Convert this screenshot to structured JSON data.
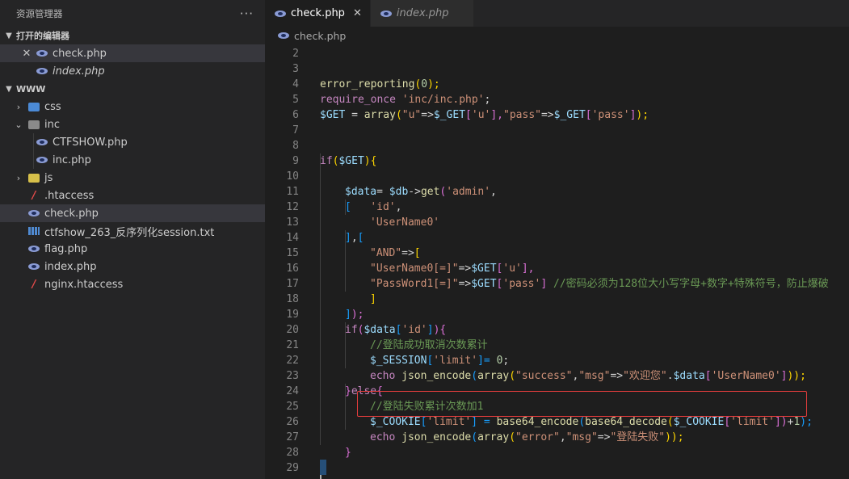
{
  "sidebar": {
    "title": "资源管理器",
    "more": "···",
    "open_editors": {
      "label": "打开的编辑器",
      "items": [
        {
          "label": "check.php"
        },
        {
          "label": "index.php"
        }
      ]
    },
    "workspace": {
      "label": "WWW",
      "items": [
        {
          "label": "css"
        },
        {
          "label": "inc"
        },
        {
          "label": "CTFSHOW.php"
        },
        {
          "label": "inc.php"
        },
        {
          "label": "js"
        },
        {
          "label": ".htaccess"
        },
        {
          "label": "check.php"
        },
        {
          "label": "ctfshow_263_反序列化session.txt"
        },
        {
          "label": "flag.php"
        },
        {
          "label": "index.php"
        },
        {
          "label": "nginx.htaccess"
        }
      ]
    }
  },
  "tabs": [
    {
      "label": "check.php",
      "close": "✕"
    },
    {
      "label": "index.php"
    }
  ],
  "breadcrumb": "check.php",
  "line_numbers": [
    "2",
    "3",
    "4",
    "5",
    "6",
    "7",
    "8",
    "9",
    "10",
    "11",
    "12",
    "13",
    "14",
    "15",
    "16",
    "17",
    "18",
    "19",
    "20",
    "21",
    "22",
    "23",
    "24",
    "25",
    "26",
    "27",
    "28",
    "29"
  ],
  "code": {
    "l3": {
      "a": "error_reporting",
      "b": "(",
      "c": "0",
      "d": ");"
    },
    "l4": {
      "a": "require_once",
      "b": " ",
      "c": "'inc/inc.php'",
      "d": ";"
    },
    "l5": {
      "a": "$GET",
      "b": " = ",
      "c": "array",
      "d": "(",
      "e": "\"u\"",
      "f": "=>",
      "g": "$_GET",
      "h": "[",
      "i": "'u'",
      "j": "],",
      "k": "\"pass\"",
      "l": "=>",
      "m": "$_GET",
      "n": "[",
      "o": "'pass'",
      "p": "]",
      "q": ");"
    },
    "l8": {
      "a": "if",
      "b": "(",
      "c": "$GET",
      "d": "){"
    },
    "l10": {
      "a": "$data",
      "b": "= ",
      "c": "$db",
      "d": "->",
      "e": "get",
      "f": "(",
      "g": "'admin'",
      "h": ","
    },
    "l11": {
      "a": "[",
      "b": "   ",
      "c": "'id'",
      "d": ","
    },
    "l12": {
      "a": "'UserName0'"
    },
    "l13": {
      "a": "]",
      "b": ",",
      "c": "["
    },
    "l14": {
      "a": "\"AND\"",
      "b": "=>",
      "c": "["
    },
    "l15": {
      "a": "\"UserName0[=]\"",
      "b": "=>",
      "c": "$GET",
      "d": "[",
      "e": "'u'",
      "f": "],"
    },
    "l16": {
      "a": "\"PassWord1[=]\"",
      "b": "=>",
      "c": "$GET",
      "d": "[",
      "e": "'pass'",
      "f": "]",
      "g": " //密码必须为128位大小写字母+数字+特殊符号，防止爆破"
    },
    "l17": {
      "a": "]"
    },
    "l18": {
      "a": "]",
      "b": ");"
    },
    "l19": {
      "a": "if",
      "b": "(",
      "c": "$data",
      "d": "[",
      "e": "'id'",
      "f": "]",
      "g": "){"
    },
    "l20": {
      "a": "//登陆成功取消次数累计"
    },
    "l21": {
      "a": "$_SESSION",
      "b": "[",
      "c": "'limit'",
      "d": "]= ",
      "e": "0",
      "f": ";"
    },
    "l22": {
      "a": "echo",
      "b": " ",
      "c": "json_encode",
      "d": "(",
      "e": "array",
      "f": "(",
      "g": "\"success\"",
      "h": ",",
      "i": "\"msg\"",
      "j": "=>",
      "k": "\"欢迎您\"",
      "l": ".",
      "m": "$data",
      "n": "[",
      "o": "'UserName0'",
      "p": "]",
      "q": "));"
    },
    "l23": {
      "a": "}",
      "b": "else",
      "c": "{"
    },
    "l24": {
      "a": "//登陆失败累计次数加1"
    },
    "l25": {
      "a": "$_COOKIE",
      "b": "[",
      "c": "'limit'",
      "d": "] = ",
      "e": "base64_encode",
      "f": "(",
      "g": "base64_decode",
      "h": "(",
      "i": "$_COOKIE",
      "j": "[",
      "k": "'limit'",
      "l": "])",
      "m": "+",
      "n": "1",
      "o": ");"
    },
    "l26": {
      "a": "echo",
      "b": " ",
      "c": "json_encode",
      "d": "(",
      "e": "array",
      "f": "(",
      "g": "\"error\"",
      "h": ",",
      "i": "\"msg\"",
      "j": "=>",
      "k": "\"登陆失败\"",
      "l": "));"
    },
    "l27": {
      "a": "}"
    },
    "l28": {
      "a": "}"
    }
  }
}
